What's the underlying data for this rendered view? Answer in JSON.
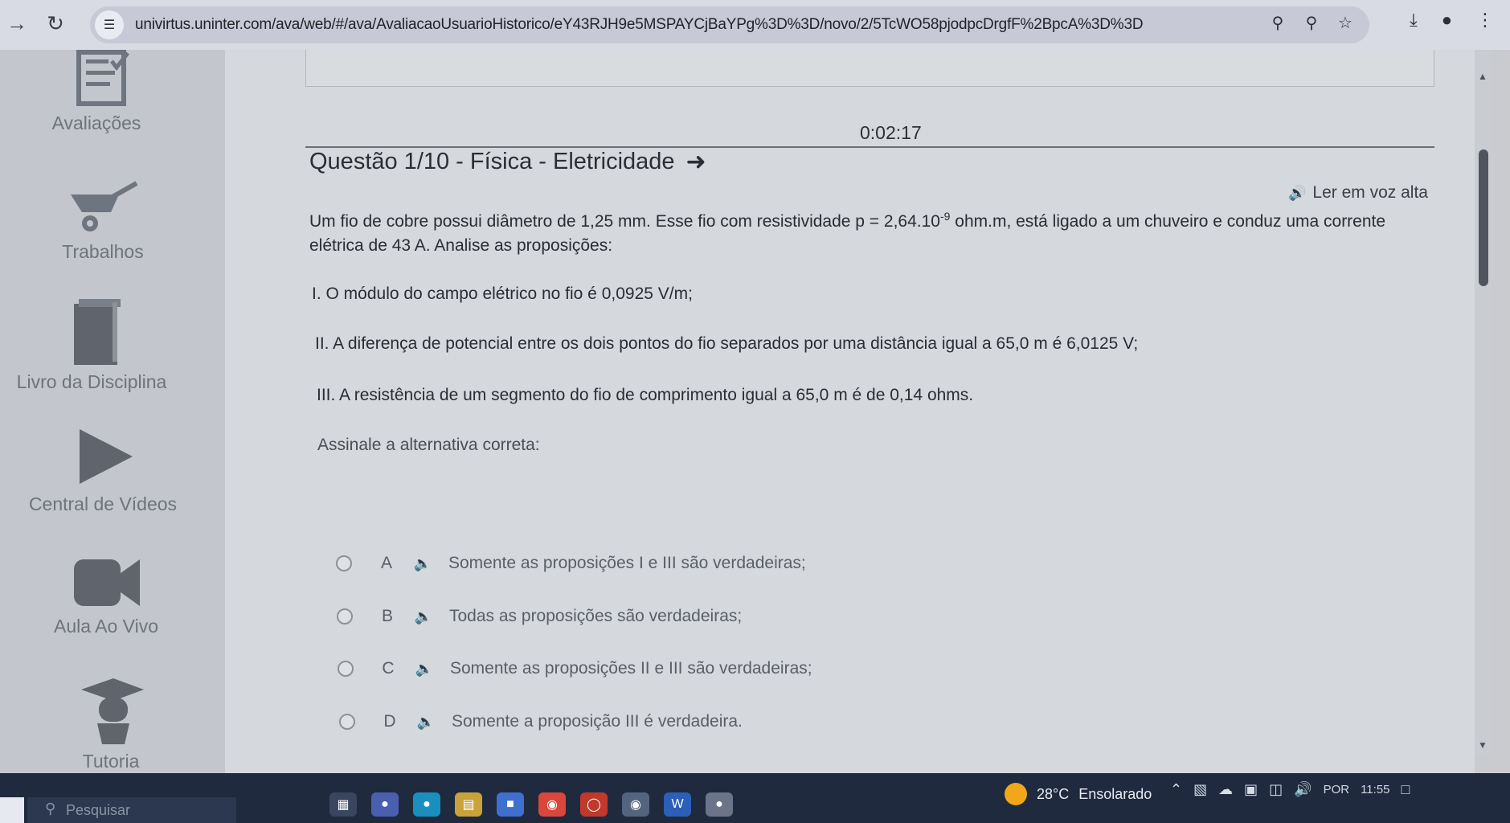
{
  "browser": {
    "url": "univirtus.uninter.com/ava/web/#/ava/AvaliacaoUsuarioHistorico/eY43RJH9e5MSPAYCjBaYPg%3D%3D/novo/2/5TcWO58pjodpcDrgfF%2BpcA%3D%3D",
    "icons": [
      "back-arrow-icon",
      "reload-icon",
      "site-info-icon",
      "key-icon",
      "zoom-icon",
      "star-icon",
      "download-icon",
      "extension-icon",
      "menu-icon"
    ]
  },
  "sidebar": {
    "items": [
      {
        "label": "Avaliações",
        "icon": "checklist-icon"
      },
      {
        "label": "Trabalhos",
        "icon": "wheelbarrow-icon"
      },
      {
        "label": "Livro da Disciplina",
        "icon": "book-icon"
      },
      {
        "label": "Central de Vídeos",
        "icon": "play-icon"
      },
      {
        "label": "Aula Ao Vivo",
        "icon": "video-camera-icon"
      },
      {
        "label": "Tutoria",
        "icon": "graduate-icon"
      }
    ]
  },
  "exam": {
    "timer": "0:02:17",
    "question_title": "Questão 1/10 - Física - Eletricidade",
    "read_aloud": "Ler em voz alta",
    "text_before_formula": "Um fio de cobre possui diâmetro de 1,25 mm. Esse fio com resistividade ",
    "formula_base": "p = 2,64.10",
    "formula_exp": "-9",
    "text_after_formula": " ohm.m, está ligado a um chuveiro e conduz uma corrente elétrica de 43 A. Analise as proposições:",
    "propositions": [
      "I. O módulo do campo elétrico no fio é 0,0925 V/m;",
      "II. A diferença de potencial entre os dois pontos do fio separados por uma distância igual a 65,0 m é 6,0125 V;",
      "III. A resistência de um segmento do fio de comprimento igual a 65,0 m é de 0,14 ohms."
    ],
    "prompt": "Assinale a alternativa correta:",
    "options": [
      {
        "letter": "A",
        "text": "Somente as proposições I e III são verdadeiras;"
      },
      {
        "letter": "B",
        "text": "Todas as proposições são verdadeiras;"
      },
      {
        "letter": "C",
        "text": "Somente as proposições II e III são verdadeiras;"
      },
      {
        "letter": "D",
        "text": "Somente a proposição III é verdadeira."
      }
    ]
  },
  "taskbar": {
    "search_placeholder": "Pesquisar",
    "weather_temp": "28°C",
    "weather_desc": "Ensolarado",
    "language": "POR",
    "time": "11:55"
  }
}
